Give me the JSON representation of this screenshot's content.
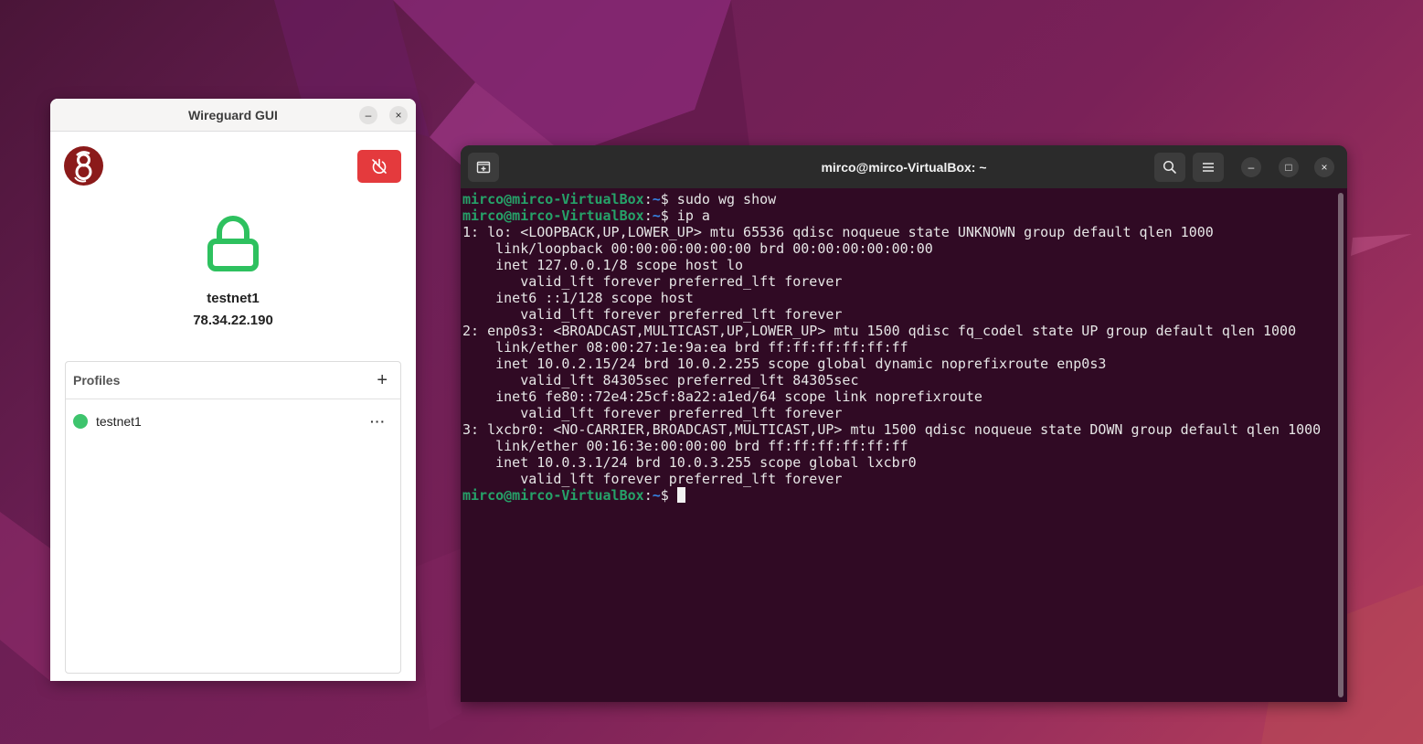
{
  "desktop": {
    "accent_colors": [
      "#4a1538",
      "#7a2158",
      "#b8405a"
    ]
  },
  "wireguard": {
    "title": "Wireguard GUI",
    "minimize_symbol": "–",
    "close_symbol": "×",
    "logo_icon": "wireguard-logo",
    "power_button_icon": "power-off-icon",
    "power_button_color": "#e43a3d",
    "status_icon": "lock-icon",
    "status_color": "#2ec15f",
    "active_profile": "testnet1",
    "active_ip": "78.34.22.190",
    "profiles_title": "Profiles",
    "add_symbol": "+",
    "profiles": [
      {
        "name": "testnet1",
        "status_color": "#3ec46d",
        "more_symbol": "···"
      }
    ]
  },
  "terminal": {
    "title": "mirco@mirco-VirtualBox: ~",
    "maximize_symbol": "□",
    "prompt_user": "mirco@mirco-VirtualBox",
    "prompt_path": "~",
    "prompt_symbol": "$",
    "lines": [
      {
        "type": "prompt",
        "command": " sudo wg show"
      },
      {
        "type": "prompt",
        "command": " ip a"
      },
      {
        "type": "out",
        "text": "1: lo: <LOOPBACK,UP,LOWER_UP> mtu 65536 qdisc noqueue state UNKNOWN group default qlen 1000"
      },
      {
        "type": "out",
        "text": "    link/loopback 00:00:00:00:00:00 brd 00:00:00:00:00:00"
      },
      {
        "type": "out",
        "text": "    inet 127.0.0.1/8 scope host lo"
      },
      {
        "type": "out",
        "text": "       valid_lft forever preferred_lft forever"
      },
      {
        "type": "out",
        "text": "    inet6 ::1/128 scope host"
      },
      {
        "type": "out",
        "text": "       valid_lft forever preferred_lft forever"
      },
      {
        "type": "out",
        "text": "2: enp0s3: <BROADCAST,MULTICAST,UP,LOWER_UP> mtu 1500 qdisc fq_codel state UP group default qlen 1000"
      },
      {
        "type": "out",
        "text": "    link/ether 08:00:27:1e:9a:ea brd ff:ff:ff:ff:ff:ff"
      },
      {
        "type": "out",
        "text": "    inet 10.0.2.15/24 brd 10.0.2.255 scope global dynamic noprefixroute enp0s3"
      },
      {
        "type": "out",
        "text": "       valid_lft 84305sec preferred_lft 84305sec"
      },
      {
        "type": "out",
        "text": "    inet6 fe80::72e4:25cf:8a22:a1ed/64 scope link noprefixroute"
      },
      {
        "type": "out",
        "text": "       valid_lft forever preferred_lft forever"
      },
      {
        "type": "out",
        "text": "3: lxcbr0: <NO-CARRIER,BROADCAST,MULTICAST,UP> mtu 1500 qdisc noqueue state DOWN group default qlen 1000"
      },
      {
        "type": "out",
        "text": "    link/ether 00:16:3e:00:00:00 brd ff:ff:ff:ff:ff:ff"
      },
      {
        "type": "out",
        "text": "    inet 10.0.3.1/24 brd 10.0.3.255 scope global lxcbr0"
      },
      {
        "type": "out",
        "text": "       valid_lft forever preferred_lft forever"
      },
      {
        "type": "prompt",
        "command": " ",
        "cursor": true
      }
    ]
  }
}
